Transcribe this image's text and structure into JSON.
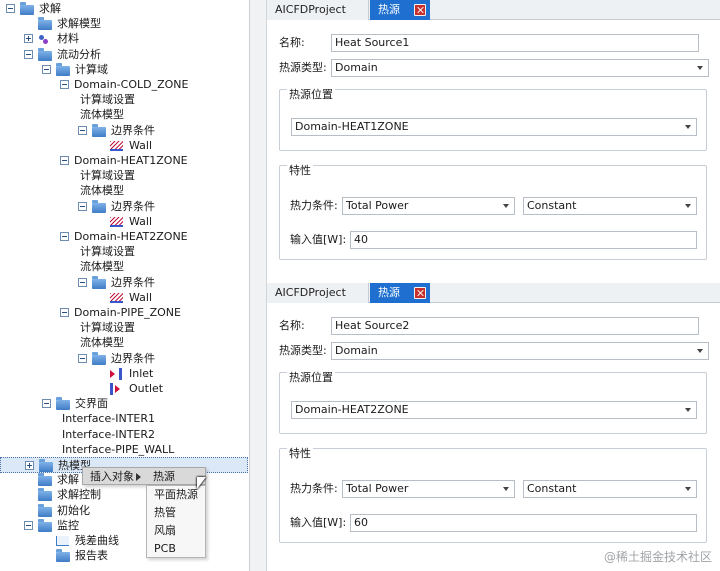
{
  "tree": {
    "items": [
      {
        "label": "求解",
        "level": 0,
        "expander": "minus",
        "icon": "folder"
      },
      {
        "label": "求解模型",
        "level": 1,
        "expander": "none",
        "icon": "folder"
      },
      {
        "label": "材料",
        "level": 1,
        "expander": "plus",
        "icon": "material"
      },
      {
        "label": "流动分析",
        "level": 1,
        "expander": "minus",
        "icon": "folder"
      },
      {
        "label": "计算域",
        "level": 2,
        "expander": "minus",
        "icon": "folder"
      },
      {
        "label": "Domain-COLD_ZONE",
        "level": 3,
        "expander": "minus",
        "icon": "none"
      },
      {
        "label": "计算域设置",
        "level": 4,
        "expander": "none",
        "icon": "none"
      },
      {
        "label": "流体模型",
        "level": 4,
        "expander": "none",
        "icon": "none"
      },
      {
        "label": "边界条件",
        "level": 4,
        "expander": "minus",
        "icon": "folder"
      },
      {
        "label": "Wall",
        "level": 5,
        "expander": "none",
        "icon": "wall"
      },
      {
        "label": "Domain-HEAT1ZONE",
        "level": 3,
        "expander": "minus",
        "icon": "none"
      },
      {
        "label": "计算域设置",
        "level": 4,
        "expander": "none",
        "icon": "none"
      },
      {
        "label": "流体模型",
        "level": 4,
        "expander": "none",
        "icon": "none"
      },
      {
        "label": "边界条件",
        "level": 4,
        "expander": "minus",
        "icon": "folder"
      },
      {
        "label": "Wall",
        "level": 5,
        "expander": "none",
        "icon": "wall"
      },
      {
        "label": "Domain-HEAT2ZONE",
        "level": 3,
        "expander": "minus",
        "icon": "none"
      },
      {
        "label": "计算域设置",
        "level": 4,
        "expander": "none",
        "icon": "none"
      },
      {
        "label": "流体模型",
        "level": 4,
        "expander": "none",
        "icon": "none"
      },
      {
        "label": "边界条件",
        "level": 4,
        "expander": "minus",
        "icon": "folder"
      },
      {
        "label": "Wall",
        "level": 5,
        "expander": "none",
        "icon": "wall"
      },
      {
        "label": "Domain-PIPE_ZONE",
        "level": 3,
        "expander": "minus",
        "icon": "none"
      },
      {
        "label": "计算域设置",
        "level": 4,
        "expander": "none",
        "icon": "none"
      },
      {
        "label": "流体模型",
        "level": 4,
        "expander": "none",
        "icon": "none"
      },
      {
        "label": "边界条件",
        "level": 4,
        "expander": "minus",
        "icon": "folder"
      },
      {
        "label": "Inlet",
        "level": 5,
        "expander": "none",
        "icon": "inlet"
      },
      {
        "label": "Outlet",
        "level": 5,
        "expander": "none",
        "icon": "outlet"
      },
      {
        "label": "交界面",
        "level": 2,
        "expander": "minus",
        "icon": "folder"
      },
      {
        "label": "Interface-INTER1",
        "level": 3,
        "expander": "none",
        "icon": "none"
      },
      {
        "label": "Interface-INTER2",
        "level": 3,
        "expander": "none",
        "icon": "none"
      },
      {
        "label": "Interface-PIPE_WALL",
        "level": 3,
        "expander": "none",
        "icon": "none"
      },
      {
        "label": "热模型",
        "level": 1,
        "expander": "plus",
        "icon": "folder",
        "selected": true
      },
      {
        "label": "求解",
        "level": 1,
        "expander": "none",
        "icon": "folder"
      },
      {
        "label": "求解控制",
        "level": 1,
        "expander": "none",
        "icon": "folder"
      },
      {
        "label": "初始化",
        "level": 1,
        "expander": "none",
        "icon": "folder"
      },
      {
        "label": "监控",
        "level": 1,
        "expander": "minus",
        "icon": "folder"
      },
      {
        "label": "残差曲线",
        "level": 2,
        "expander": "none",
        "icon": "chart"
      },
      {
        "label": "报告表",
        "level": 2,
        "expander": "none",
        "icon": "folder"
      }
    ]
  },
  "context_menu": {
    "item_label": "插入对象",
    "submenu_label": "热源",
    "submenu_items": [
      "平面热源",
      "热管",
      "风扇",
      "PCB"
    ]
  },
  "panels": [
    {
      "tab_project": "AICFDProject",
      "tab_active": "热源",
      "name_label": "名称:",
      "name_value": "Heat Source1",
      "type_label": "热源类型:",
      "type_value": "Domain",
      "position_group": "热源位置",
      "position_value": "Domain-HEAT1ZONE",
      "props_group": "特性",
      "thermal_label": "热力条件:",
      "thermal_value": "Total Power",
      "mode_value": "Constant",
      "input_label": "输入值[W]:",
      "input_value": "40"
    },
    {
      "tab_project": "AICFDProject",
      "tab_active": "热源",
      "name_label": "名称:",
      "name_value": "Heat Source2",
      "type_label": "热源类型:",
      "type_value": "Domain",
      "position_group": "热源位置",
      "position_value": "Domain-HEAT2ZONE",
      "props_group": "特性",
      "thermal_label": "热力条件:",
      "thermal_value": "Total Power",
      "mode_value": "Constant",
      "input_label": "输入值[W]:",
      "input_value": "60"
    }
  ],
  "watermark": "@稀土掘金技术社区",
  "colors": {
    "tab_active_bg": "#1e6fd0",
    "tab_close_bg": "#c8302c",
    "folder_blue": "#3f7cc6",
    "selected_row_bg": "#dbe8f8"
  }
}
